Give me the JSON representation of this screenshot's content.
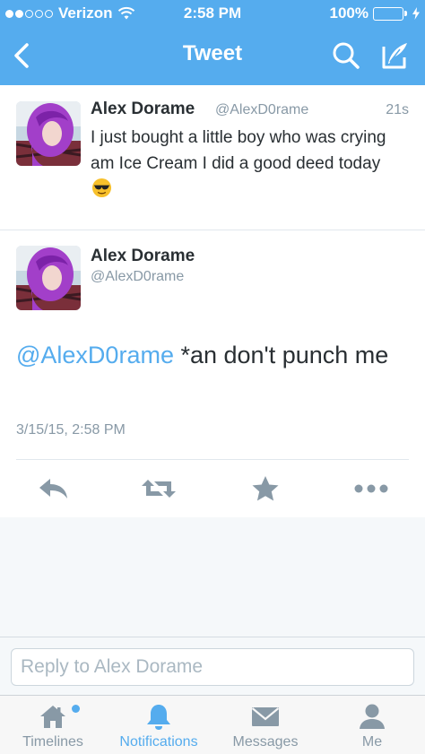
{
  "status_bar": {
    "carrier": "Verizon",
    "time": "2:58 PM",
    "battery": "100%"
  },
  "nav": {
    "title": "Tweet"
  },
  "first_tweet": {
    "name": "Alex Dorame",
    "handle": "@AlexD0rame",
    "time": "21s",
    "text": "I just bought a little boy who was crying am Ice Cream I did a good deed today",
    "emoji": "sunglasses-emoji"
  },
  "main_tweet": {
    "name": "Alex Dorame",
    "handle": "@AlexD0rame",
    "mention": "@AlexD0rame",
    "text": " *an don't punch me",
    "date": "3/15/15, 2:58 PM"
  },
  "reply": {
    "placeholder": "Reply to Alex Dorame"
  },
  "tabs": [
    {
      "label": "Timelines",
      "icon": "home-icon"
    },
    {
      "label": "Notifications",
      "icon": "bell-icon"
    },
    {
      "label": "Messages",
      "icon": "envelope-icon"
    },
    {
      "label": "Me",
      "icon": "person-icon"
    }
  ],
  "colors": {
    "brand": "#55acee",
    "text": "#292f33",
    "muted": "#8899a6",
    "battery": "#6fe06f"
  }
}
